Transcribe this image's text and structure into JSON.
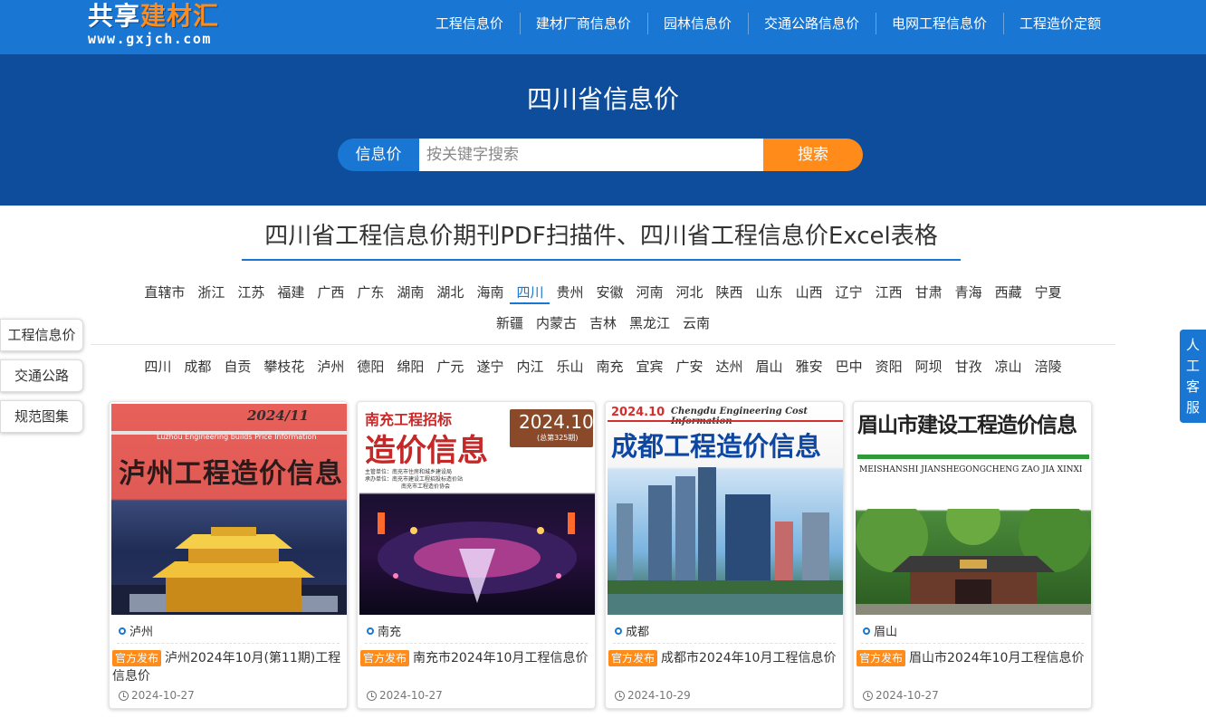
{
  "logo": {
    "cn_part1": "共享",
    "cn_part2": "建材汇",
    "url": "www.gxjch.com"
  },
  "nav": [
    "工程信息价",
    "建材厂商信息价",
    "园林信息价",
    "交通公路信息价",
    "电网工程信息价",
    "工程造价定额"
  ],
  "hero": {
    "title": "四川省信息价",
    "search_label": "信息价",
    "search_placeholder": "按关键字搜索",
    "search_button": "搜索"
  },
  "section_title": "四川省工程信息价期刊PDF扫描件、四川省工程信息价Excel表格",
  "provinces_row1": [
    "直辖市",
    "浙江",
    "江苏",
    "福建",
    "广西",
    "广东",
    "湖南",
    "湖北",
    "海南",
    "四川",
    "贵州",
    "安徽",
    "河南",
    "河北",
    "陕西",
    "山东",
    "山西",
    "辽宁",
    "江西",
    "甘肃",
    "青海",
    "西藏",
    "宁夏"
  ],
  "provinces_row2": [
    "新疆",
    "内蒙古",
    "吉林",
    "黑龙江",
    "云南"
  ],
  "active_province": "四川",
  "cities": [
    "四川",
    "成都",
    "自贡",
    "攀枝花",
    "泸州",
    "德阳",
    "绵阳",
    "广元",
    "遂宁",
    "内江",
    "乐山",
    "南充",
    "宜宾",
    "广安",
    "达州",
    "眉山",
    "雅安",
    "巴中",
    "资阳",
    "阿坝",
    "甘孜",
    "凉山",
    "涪陵"
  ],
  "side_menu": [
    "工程信息价",
    "交通公路",
    "规范图集"
  ],
  "service": [
    "人",
    "工",
    "客",
    "服"
  ],
  "badge_label": "官方发布",
  "colors": {
    "primary": "#1976d2",
    "hero": "#0d4d9b",
    "accent": "#ff8c1a"
  },
  "cards": [
    {
      "city": "泸州",
      "title": "泸州2024年10月(第11期)工程信息价",
      "date": "2024-10-27",
      "cover": {
        "issue": "2024/11",
        "subtitle": "Luzhou Engineering builds Price Information",
        "heading": "泸州工程造价信息"
      }
    },
    {
      "city": "南充",
      "title": "南充市2024年10月工程信息价",
      "date": "2024-10-27",
      "cover": {
        "top": "南充工程招标",
        "heading": "造价信息",
        "issue": "2024.10",
        "issue_no": "(总第325期)",
        "lines": [
          "主管单位：南充市住房和城乡建设局",
          "承办单位：南充市建设工程招投标造价站",
          "南充市工程造价协会"
        ]
      }
    },
    {
      "city": "成都",
      "title": "成都市2024年10月工程信息价",
      "date": "2024-10-29",
      "cover": {
        "issue": "2024.10",
        "subtitle": "Chengdu Engineering Cost Information",
        "heading": "成都工程造价信息"
      }
    },
    {
      "city": "眉山",
      "title": "眉山市2024年10月工程信息价",
      "date": "2024-10-27",
      "cover": {
        "heading": "眉山市建设工程造价信息",
        "pinyin": "MEISHANSHI JIANSHEGONGCHENG ZAO JIA XINXI"
      }
    }
  ]
}
